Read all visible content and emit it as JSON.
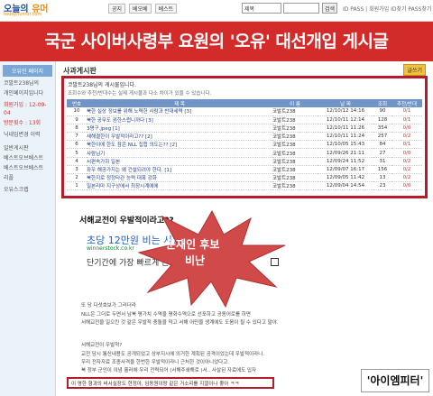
{
  "top": {
    "logo_prefix": "오늘의",
    "logo_org": "유머",
    "logo_sub": "todayhumor.com",
    "nav": [
      "공지",
      "베오베",
      "베스트"
    ],
    "search_select": "제목",
    "search_btn": "검색",
    "id_label": "ID  PASS  | 회원가입 ID찾기 PASS찾기"
  },
  "banner": "국군 사이버사령부 요원의 '오유' 대선개입 게시글",
  "sidebar": {
    "box_title": "오유인 페이지",
    "lines": [
      "코발트238님의",
      "개인페이지입니다",
      "",
      "회원가입 : 12-09-04",
      "방문횟수 : 13회",
      "",
      "닉네임변경 이력",
      "",
      "",
      "일반게시판",
      "베스트오브베스트",
      "베스트오브베스트",
      "리플",
      "",
      "오유스크랩"
    ]
  },
  "main": {
    "section_title": "사과게시판",
    "write_btn": "글쓰기"
  },
  "board": {
    "title": "코발트238님의 게시물입니다.",
    "notice": "조회수와 추천/반대수는 실제 게시물과 다소 차이가 있을 수 있습니다.",
    "headers": [
      "번호",
      "제 목",
      "이 름",
      "날 짜",
      "조회",
      "추천/반대"
    ],
    "rows": [
      [
        "10",
        "북한 실상 정보를 위해 노력한 사람과 반대세력 [3]",
        "코발트238",
        "12/10/12 14:16",
        "90",
        "0/1"
      ],
      [
        "9",
        "북한 공무도 권한스럽니까다 [3]",
        "코발트238",
        "12/10/11 12:14",
        "128",
        "0/1"
      ],
      [
        "8",
        "3명구.jpeg [1]",
        "코발트238",
        "12/10/11 11:26",
        "354",
        "0/0"
      ],
      [
        "7",
        "새해결한이 우발적이라고?? [2]",
        "코발트238",
        "12/10/11 11:24",
        "257",
        "0/2"
      ],
      [
        "6",
        "북한이에 한도 잠은 NLL 집합 의도는?? [2]",
        "코발트238",
        "12/10/05 15:43",
        "84",
        "0/1"
      ],
      [
        "5",
        "사람님기",
        "코발트238",
        "12/09/26 21:11",
        "27",
        "0/0"
      ],
      [
        "4",
        "서편속가하 일본",
        "코발트238",
        "12/09/24 11:52",
        "31",
        "0/2"
      ],
      [
        "3",
        "좌우 해공가지는 왜 건설되려야 한다. [1]",
        "코발트238",
        "12/09/07 16:17",
        "156",
        "0/2"
      ],
      [
        "2",
        "북한지로 정정타관 능력 대폭 강화",
        "코발트238",
        "12/09/05 11:42",
        "13",
        "0/2"
      ],
      [
        "1",
        "일본리마 지구상에서 최장시계에에",
        "코발트238",
        "12/09/04 14:54",
        "23",
        "0/0"
      ]
    ]
  },
  "post": {
    "title": "서해교전이 우발적이라고??",
    "date": "",
    "ad_main": "초당 12만원 비는 사람들",
    "ad_url": "winnerstock.co.kr",
    "ad_sub": "단기간에 가장 빠르게 돈벌 수 있는 방법",
    "star_line1": "문재인 후보",
    "star_line2": "비난",
    "paragraphs": [
      "또 당 다섯호보가 그러더라",
      "NLL은 그더로 두면서 남북 평가치 수역을 평화수역으로 선포하고 공동어로를 하면",
      "서해교전을 일으킨 것 같은 우발적 충돌을 막고 서해 어민을 생계에도 도움이 될 수 있다고 말야.",
      "",
      "서해교전이 우발적?",
      "교전 당시 통신내용도 공개되었고 상부지시에 의거한 계획된 공격이었는데 우발적이라니.",
      "우리 전자자료 조종사격을 한번한 우발적이라니 근처한 것이아니었다고.",
      "북 정부 군인이 이념 흘러에 우리 전력되어 (서해주쇄해로 )서.. 사살된 자료에도 입자"
    ],
    "highlight": "이 명한 형과의 비서실장도 현정아, 임동원이랑 같은 거소리를 지껄이나 좋아 ㅋㅋ",
    "watermark": "'아이엠피터'"
  },
  "colors": {
    "banner": "#d32a2a",
    "frame": "#b51c2b",
    "header": "#6f95c7"
  }
}
